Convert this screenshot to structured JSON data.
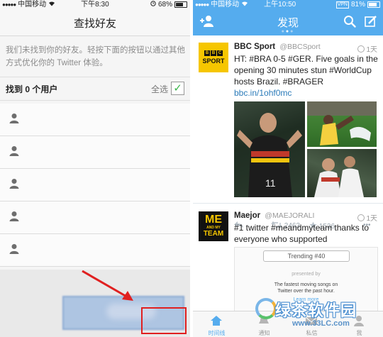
{
  "left": {
    "status": {
      "carrier": "中国移动",
      "time": "下午8:30",
      "battery": "68%",
      "battery_fill": 0.68
    },
    "title": "查找好友",
    "message": "我们未找到你的好友。轻按下面的按钮以通过其他方式优化你的 Twitter 体验。",
    "found_label": "找到 0 个用户",
    "select_all_label": "全选",
    "select_all_checked": true,
    "user_rows": [
      {
        "icon": "person-icon"
      },
      {
        "icon": "person-icon"
      },
      {
        "icon": "person-icon"
      },
      {
        "icon": "person-icon"
      },
      {
        "icon": "person-icon"
      }
    ]
  },
  "right": {
    "status": {
      "carrier": "中国移动",
      "time": "上午10:50",
      "battery": "81%",
      "battery_fill": 0.81,
      "vpn": "VPN"
    },
    "title": "发现",
    "accent": "#55acee",
    "tweets": [
      {
        "name": "BBC Sport",
        "handle": "@BBCSport",
        "time": "1天",
        "text": "HT: #BRA 0-5 #GER. Five goals in the opening 30 minutes stun #WorldCup hosts Brazil. #BRAGER ",
        "link": "bbc.in/1ohf0mc",
        "retweets": "2463",
        "favorites": "1536",
        "avatar": {
          "blocks": [
            "B",
            "B",
            "C"
          ],
          "word": "SPORT"
        }
      },
      {
        "name": "Maejor",
        "handle": "@MAEJORALI",
        "time": "1天",
        "text": "#1 twitter #meandmyteam thanks to everyone who supported",
        "avatar": {
          "line1": "ME",
          "line2": "AND MY",
          "line3": "TEAM"
        },
        "card": {
          "pill": "Trending #40",
          "promoted": "presented by",
          "line1": "The fastest moving songs on",
          "line2": "Twitter over the past hour.",
          "learn": "Learn more"
        }
      }
    ],
    "tabs": [
      {
        "label": "时间线",
        "active": true
      },
      {
        "label": "通知",
        "active": false
      },
      {
        "label": "私信",
        "active": false
      },
      {
        "label": "我",
        "active": false
      }
    ]
  },
  "watermark": {
    "title": "绿茶软件园",
    "url": "www.33LC.com"
  }
}
